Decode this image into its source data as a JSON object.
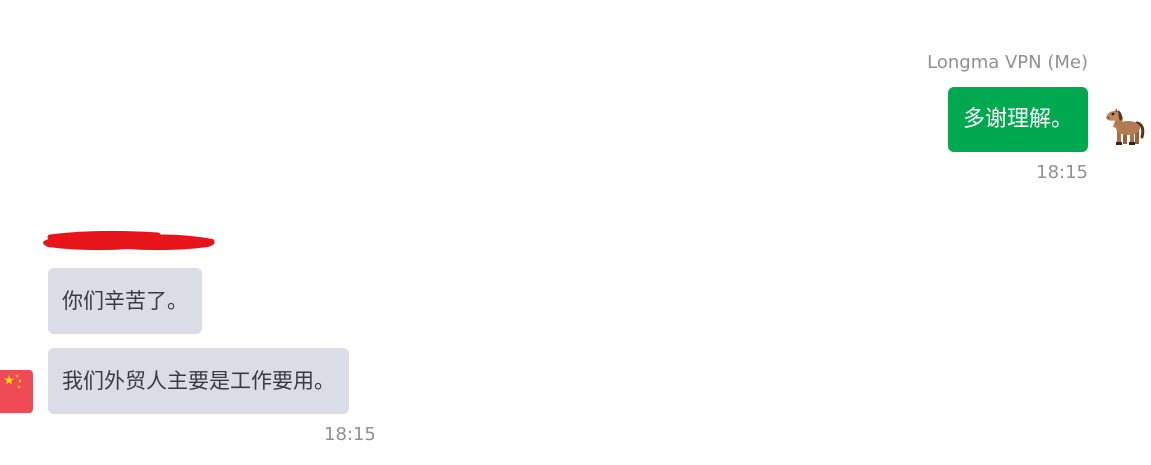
{
  "outgoing": {
    "sender": "Longma VPN (Me)",
    "message": "多谢理解。",
    "time": "18:15",
    "avatar_icon": "horse-icon",
    "bubble_color": "#00a84f"
  },
  "incoming": {
    "sender_redacted": true,
    "messages": [
      "你们辛苦了。",
      "我们外贸人主要是工作要用。"
    ],
    "time": "18:15",
    "avatar_icon": "china-flag-icon",
    "bubble_color": "#dadce6"
  }
}
